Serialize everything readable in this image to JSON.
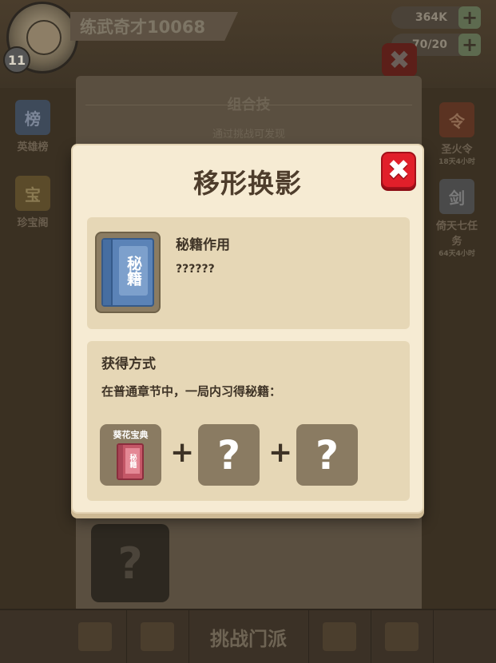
{
  "background": {
    "player_name": "练武奇才10068",
    "player_level": "11",
    "currency_amount": "364K",
    "stamina": "70/20",
    "panel_title": "组合技",
    "panel_subtitle": "通过挑战可发现",
    "mystery_mark": "?",
    "side_left": [
      {
        "label": "英雄榜",
        "icon": "榜"
      },
      {
        "label": "珍宝阁",
        "icon": "宝"
      }
    ],
    "side_right": [
      {
        "label": "圣火令",
        "sub": "18天4小时",
        "icon": "令"
      },
      {
        "label": "倚天七任务",
        "sub": "64天4小时",
        "icon": "剑"
      }
    ],
    "bottom_tabs": [
      {
        "label": "",
        "icon": "任"
      },
      {
        "label": "",
        "icon": "书"
      },
      {
        "label": "挑战门派",
        "icon": ""
      },
      {
        "label": "",
        "icon": "箱"
      },
      {
        "label": "",
        "icon": "收"
      }
    ]
  },
  "dialog": {
    "title": "移形换影",
    "close_symbol": "✖",
    "book_label": "秘籍",
    "effect_title": "秘籍作用",
    "effect_text": "??????",
    "source_title": "获得方式",
    "source_text": "在普通章节中，一局内习得秘籍：",
    "ingredients": [
      {
        "name": "葵花宝典",
        "book_label": "秘籍",
        "known": true
      },
      {
        "name": "?",
        "known": false
      },
      {
        "name": "?",
        "known": false
      }
    ],
    "plus_symbol": "+"
  },
  "colors": {
    "dialog_bg": "#f6ebd3",
    "card_bg": "#e6d7b6",
    "close_red": "#e11f2a",
    "book_blue": "#5b83b7",
    "book_red": "#c45767",
    "slot_bg": "#8a7b62"
  }
}
